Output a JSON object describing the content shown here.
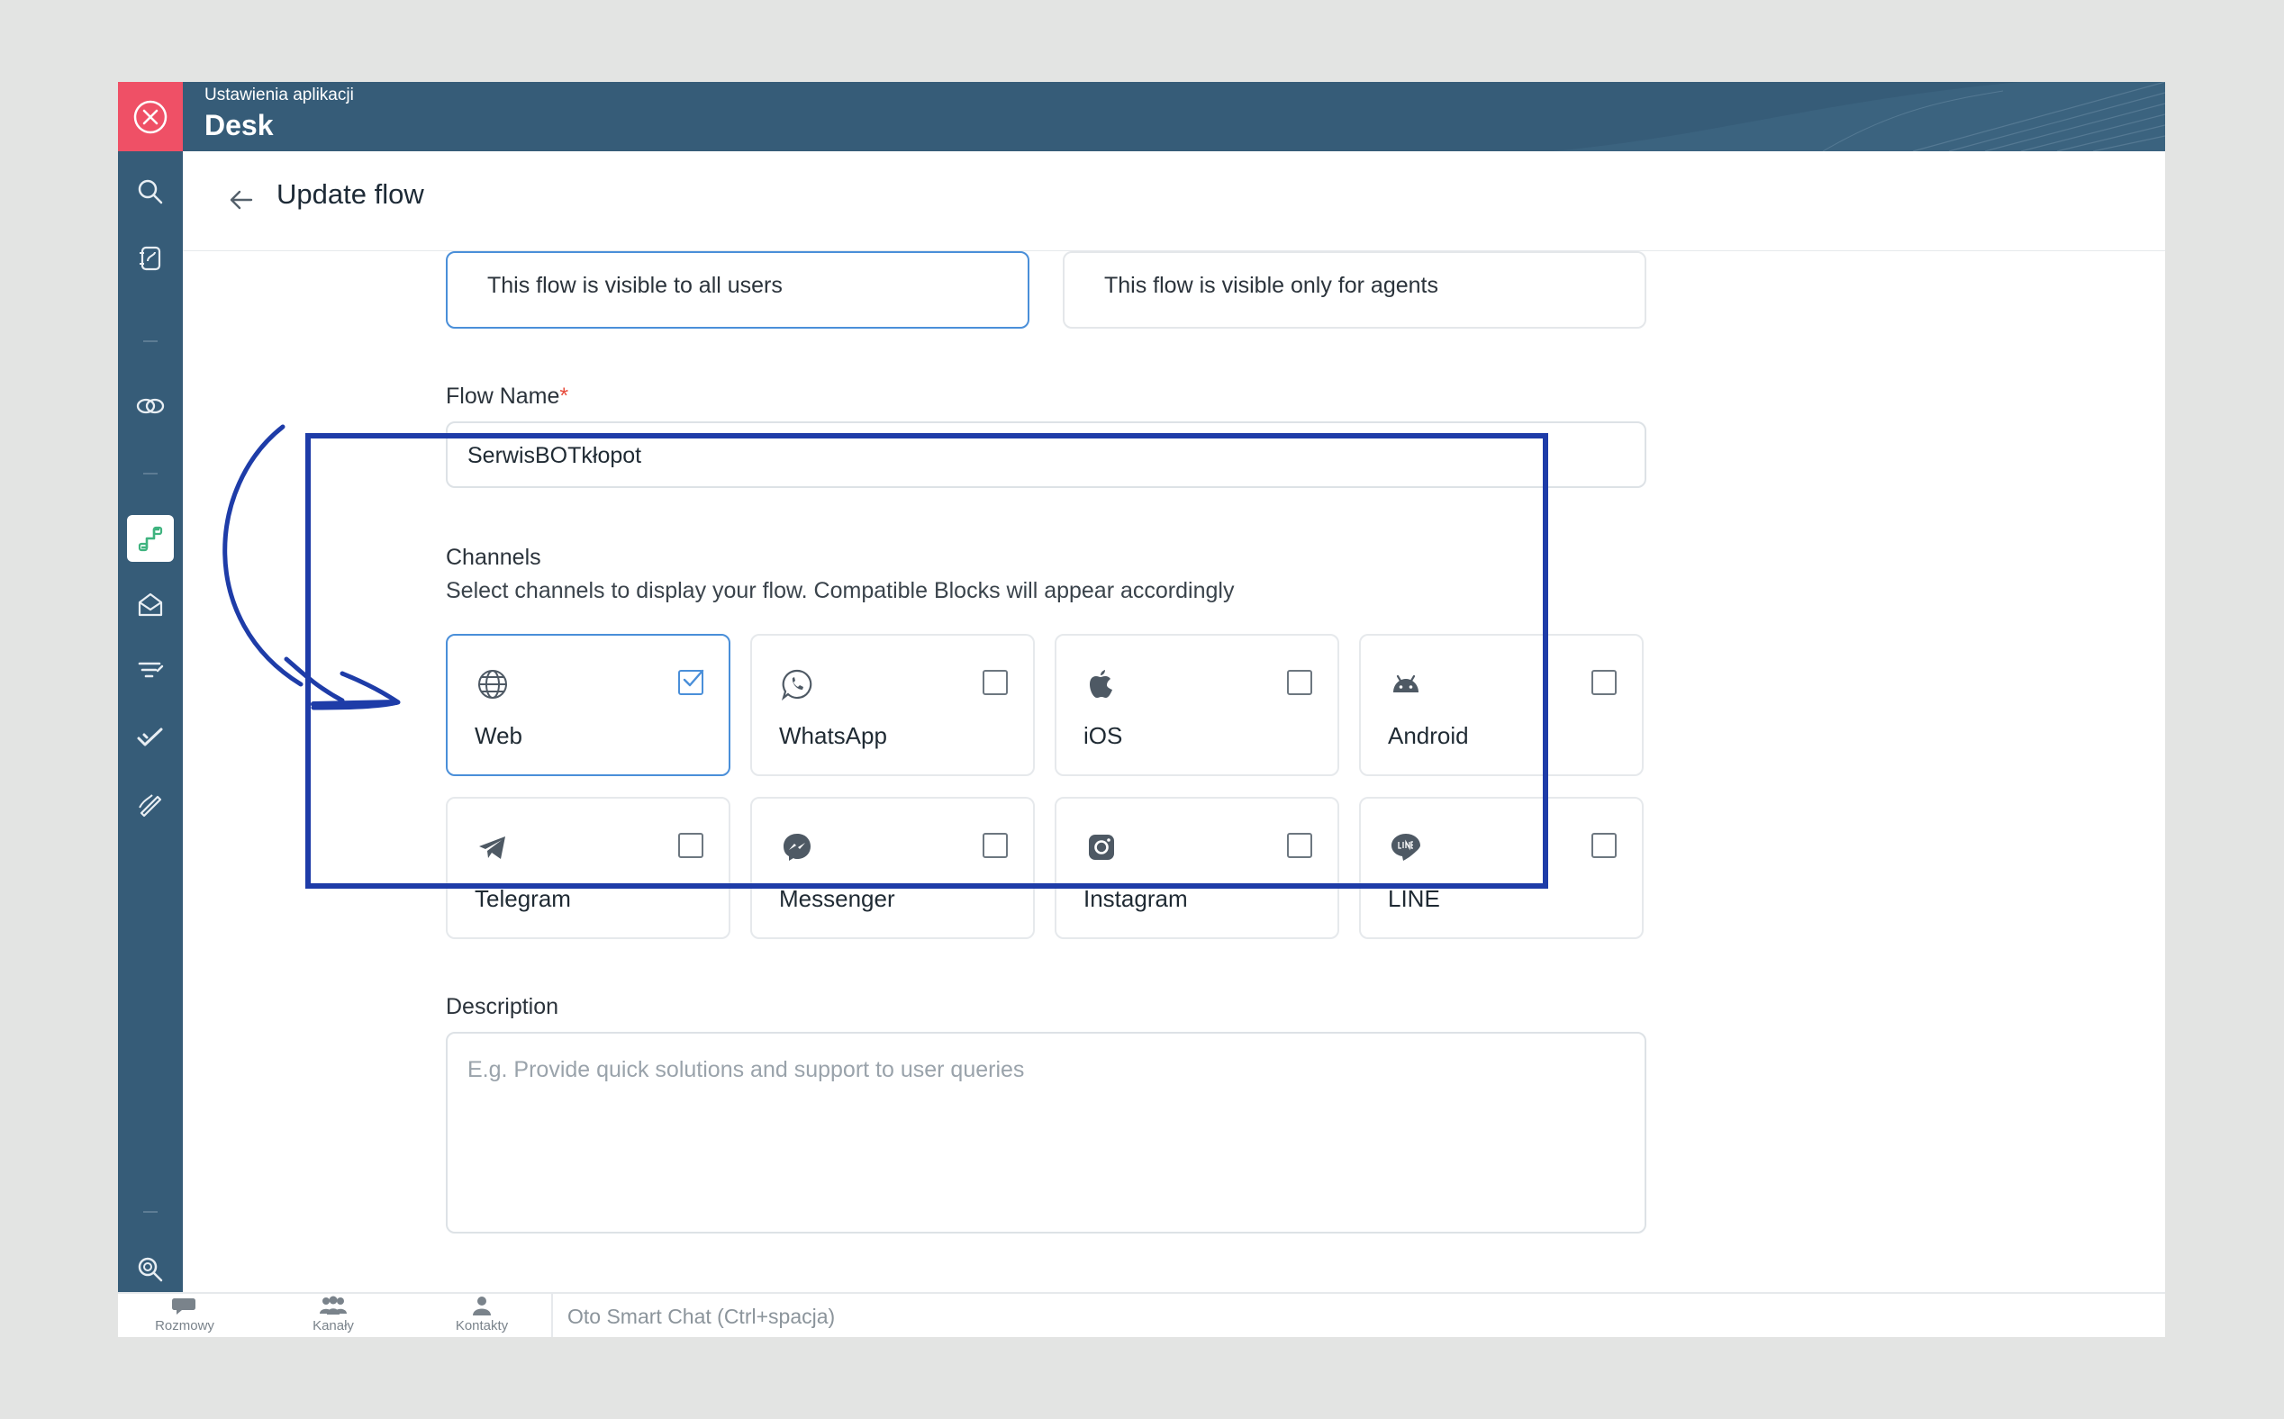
{
  "app": {
    "subtitle": "Ustawienia aplikacji",
    "title": "Desk"
  },
  "header": {
    "title": "Update flow"
  },
  "visibility": {
    "options": [
      {
        "text": "This flow is visible to all users",
        "selected": true
      },
      {
        "text": "This flow is visible only for agents",
        "selected": false
      }
    ]
  },
  "flow_name": {
    "label": "Flow Name",
    "required_mark": "*",
    "value": "SerwisBOTkłopot"
  },
  "channels": {
    "title": "Channels",
    "subtitle": "Select channels to display your flow. Compatible Blocks will appear accordingly",
    "items": [
      {
        "name": "Web",
        "icon": "globe-icon",
        "checked": true
      },
      {
        "name": "WhatsApp",
        "icon": "whatsapp-icon",
        "checked": false
      },
      {
        "name": "iOS",
        "icon": "apple-icon",
        "checked": false
      },
      {
        "name": "Android",
        "icon": "android-icon",
        "checked": false
      },
      {
        "name": "Telegram",
        "icon": "telegram-icon",
        "checked": false
      },
      {
        "name": "Messenger",
        "icon": "messenger-icon",
        "checked": false
      },
      {
        "name": "Instagram",
        "icon": "instagram-icon",
        "checked": false
      },
      {
        "name": "LINE",
        "icon": "line-icon",
        "checked": false
      }
    ]
  },
  "description": {
    "label": "Description",
    "placeholder": "E.g. Provide quick solutions and support to user queries"
  },
  "bottombar": {
    "items": [
      {
        "label": "Rozmowy",
        "icon": "chat-bubble-icon"
      },
      {
        "label": "Kanały",
        "icon": "group-icon"
      },
      {
        "label": "Kontakty",
        "icon": "person-icon"
      }
    ],
    "input_placeholder": "Oto Smart Chat (Ctrl+spacja)"
  },
  "colors": {
    "sidebar": "#365c78",
    "close": "#ef5066",
    "accent": "#4a8fd9",
    "highlight": "#1e3ca8"
  }
}
